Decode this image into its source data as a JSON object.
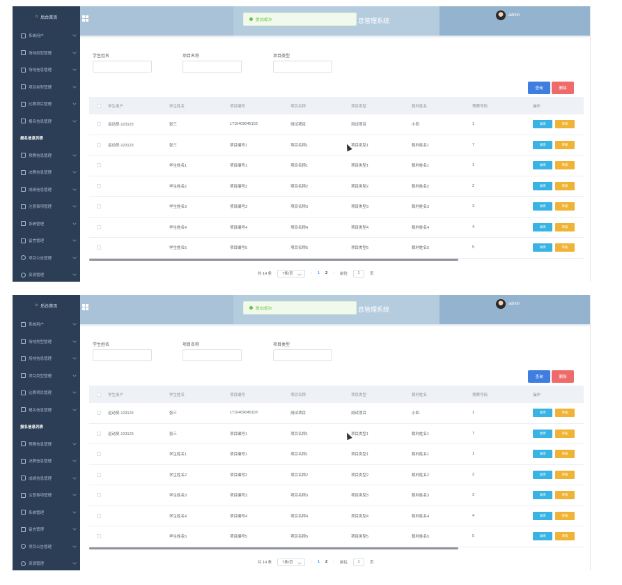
{
  "sidebar": {
    "home_label": "后台首页",
    "items": [
      {
        "label": "系统用户",
        "icon": "person-icon"
      },
      {
        "label": "场地类型管理",
        "icon": "doc-icon"
      },
      {
        "label": "场地信息管理",
        "icon": "doc-icon"
      },
      {
        "label": "项目类型管理",
        "icon": "doc-icon"
      },
      {
        "label": "比赛项目管理",
        "icon": "doc-icon"
      },
      {
        "label": "报名信息管理",
        "icon": "doc-icon"
      },
      {
        "label": "报名信息列表",
        "icon": "",
        "active": true
      },
      {
        "label": "预赛信息管理",
        "icon": "doc-icon"
      },
      {
        "label": "决赛信息管理",
        "icon": "doc-icon"
      },
      {
        "label": "成绩信息管理",
        "icon": "doc-icon"
      },
      {
        "label": "注意事项管理",
        "icon": "doc-icon"
      },
      {
        "label": "系统管理",
        "icon": "grid-icon"
      },
      {
        "label": "留言管理",
        "icon": "grid-icon"
      },
      {
        "label": "项目公告管理",
        "icon": "clock-icon"
      },
      {
        "label": "资源管理",
        "icon": "pin-icon"
      }
    ]
  },
  "header": {
    "system_title": "息管理系统",
    "username": "admin"
  },
  "toast": {
    "message": "提交成功!"
  },
  "filters": [
    {
      "label": "学生姓名",
      "value": ""
    },
    {
      "label": "项目名称",
      "value": ""
    },
    {
      "label": "项目类型",
      "value": ""
    }
  ],
  "buttons": {
    "search": "查询",
    "delete": "删除",
    "detail": "详情",
    "audit": "审核"
  },
  "table": {
    "headers": [
      "学生用户",
      "学生姓名",
      "项目编号",
      "项目名称",
      "项目类型",
      "裁判姓名",
      "预赛号码",
      "操作"
    ],
    "rows": [
      [
        "运动员-123123",
        "张三",
        "1710409045103",
        "测试项目",
        "测试项目",
        "小四",
        "1"
      ],
      [
        "运动员-123123",
        "张三",
        "项目编号1",
        "项目名称1",
        "项目类型1",
        "裁判姓名1",
        "7"
      ],
      [
        "",
        "学生姓名1",
        "项目编号1",
        "项目名称1",
        "项目类型1",
        "裁判姓名1",
        "1"
      ],
      [
        "",
        "学生姓名2",
        "项目编号2",
        "项目名称2",
        "项目类型2",
        "裁判姓名2",
        "2"
      ],
      [
        "",
        "学生姓名3",
        "项目编号3",
        "项目名称3",
        "项目类型3",
        "裁判姓名3",
        "3"
      ],
      [
        "",
        "学生姓名4",
        "项目编号4",
        "项目名称4",
        "项目类型4",
        "裁判姓名4",
        "4"
      ],
      [
        "",
        "学生姓名5",
        "项目编号5",
        "项目名称5",
        "项目类型5",
        "裁判姓名5",
        "5"
      ]
    ]
  },
  "pagination": {
    "total_text": "共 14 条",
    "page_size_text": "7条/页",
    "prev": "‹",
    "pages": [
      "1",
      "2"
    ],
    "current": "1",
    "next": "›",
    "goto_prefix": "前往",
    "goto_value": "1",
    "goto_suffix": "页"
  },
  "colors": {
    "sidebar_bg": "#2c3e55",
    "topbar_bg": "#a9c2d8",
    "search_button": "#3f7de0",
    "delete_button": "#ef6b6b",
    "detail_button": "#38b3e3",
    "audit_button": "#efb336",
    "toast_text": "#67c23a"
  }
}
